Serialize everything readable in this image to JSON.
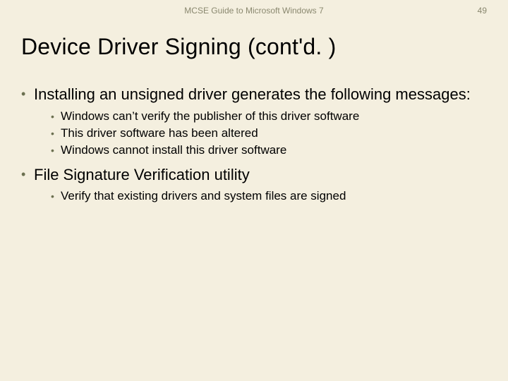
{
  "header": {
    "source": "MCSE Guide to Microsoft Windows 7",
    "page_number": "49"
  },
  "title": "Device Driver Signing (cont'd. )",
  "bullets": [
    {
      "text": "Installing an unsigned driver generates the following messages:",
      "sub": [
        "Windows can’t verify the publisher of this driver software",
        "This driver software has been altered",
        "Windows cannot install this driver software"
      ]
    },
    {
      "text": "File Signature Verification utility",
      "sub": [
        "Verify that existing drivers and system files are signed"
      ]
    }
  ]
}
